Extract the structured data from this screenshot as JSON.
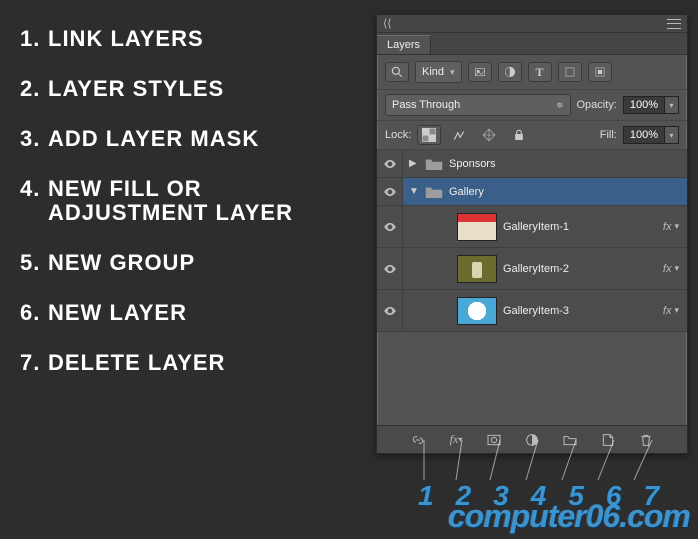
{
  "legend": [
    {
      "n": "1.",
      "label": "Link Layers"
    },
    {
      "n": "2.",
      "label": "Layer Styles"
    },
    {
      "n": "3.",
      "label": "Add Layer Mask"
    },
    {
      "n": "4.",
      "label": "New Fill or"
    },
    {
      "n": "",
      "label": "Adjustment Layer"
    },
    {
      "n": "5.",
      "label": "New Group"
    },
    {
      "n": "6.",
      "label": "New Layer"
    },
    {
      "n": "7.",
      "label": "Delete Layer"
    }
  ],
  "panel": {
    "title": "Layers",
    "filter": {
      "label": "Kind"
    },
    "blend_mode": "Pass Through",
    "opacity": {
      "label": "Opacity:",
      "value": "100%"
    },
    "lock": {
      "label": "Lock:"
    },
    "fill": {
      "label": "Fill:",
      "value": "100%"
    },
    "layers": [
      {
        "type": "group",
        "name": "Sponsors",
        "expanded": false
      },
      {
        "type": "group",
        "name": "Gallery",
        "expanded": true,
        "selected": true
      },
      {
        "type": "layer",
        "name": "GalleryItem-1",
        "fx": true,
        "thumb": "t1"
      },
      {
        "type": "layer",
        "name": "GalleryItem-2",
        "fx": true,
        "thumb": "t2"
      },
      {
        "type": "layer",
        "name": "GalleryItem-3",
        "fx": true,
        "thumb": "t3"
      }
    ],
    "callout_numbers": [
      "1",
      "2",
      "3",
      "4",
      "5",
      "6",
      "7"
    ]
  },
  "watermark": "computer06.com"
}
